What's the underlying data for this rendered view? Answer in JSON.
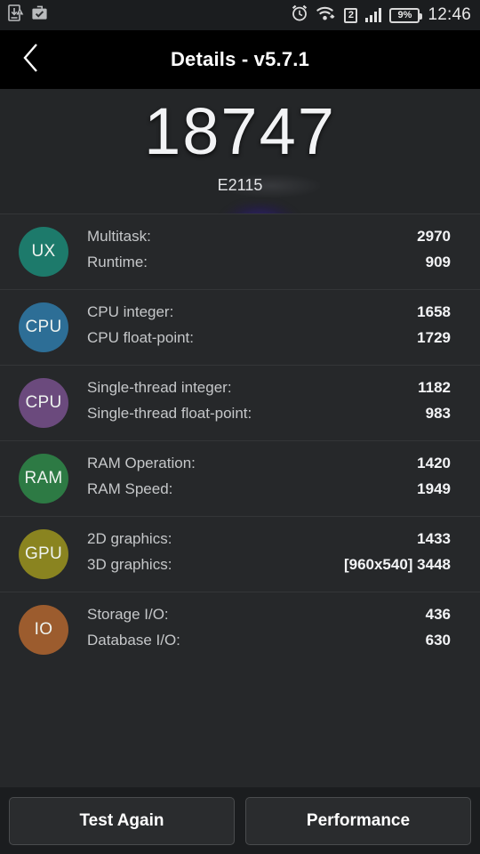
{
  "statusbar": {
    "icons_left": [
      "download-icon",
      "briefcase-check-icon"
    ],
    "alarm_icon": "alarm-clock-icon",
    "wifi_icon": "wifi-icon",
    "sim_label": "2",
    "signal_icon": "signal-bars-icon",
    "battery_percent": "9%",
    "time": "12:46"
  },
  "titlebar": {
    "back_icon": "back-chevron-icon",
    "title": "Details - v5.7.1"
  },
  "hero": {
    "score": "18747",
    "device": "E2115"
  },
  "colors": {
    "background": "#26282a",
    "ux": "#1d7a6b",
    "cpu_multi": "#2d6e96",
    "cpu_single": "#6b4a7d",
    "ram": "#2d7a44",
    "gpu": "#8a8420",
    "io": "#9c5c2e",
    "glow": "#3b24b4"
  },
  "rows": [
    {
      "badge": "UX",
      "badge_color": "#1d7a6b",
      "metrics": [
        {
          "label": "Multitask:",
          "value": "2970"
        },
        {
          "label": "Runtime:",
          "value": "909"
        }
      ]
    },
    {
      "badge": "CPU",
      "badge_color": "#2d6e96",
      "metrics": [
        {
          "label": "CPU integer:",
          "value": "1658"
        },
        {
          "label": "CPU float-point:",
          "value": "1729"
        }
      ]
    },
    {
      "badge": "CPU",
      "badge_color": "#6b4a7d",
      "metrics": [
        {
          "label": "Single-thread integer:",
          "value": "1182"
        },
        {
          "label": "Single-thread float-point:",
          "value": "983"
        }
      ]
    },
    {
      "badge": "RAM",
      "badge_color": "#2d7a44",
      "metrics": [
        {
          "label": "RAM Operation:",
          "value": "1420"
        },
        {
          "label": "RAM Speed:",
          "value": "1949"
        }
      ]
    },
    {
      "badge": "GPU",
      "badge_color": "#8a8420",
      "metrics": [
        {
          "label": "2D graphics:",
          "value": "1433"
        },
        {
          "label": "3D graphics:",
          "value": "[960x540] 3448"
        }
      ]
    },
    {
      "badge": "IO",
      "badge_color": "#9c5c2e",
      "metrics": [
        {
          "label": "Storage I/O:",
          "value": "436"
        },
        {
          "label": "Database I/O:",
          "value": "630"
        }
      ]
    }
  ],
  "buttons": {
    "test_again": "Test Again",
    "performance": "Performance"
  }
}
